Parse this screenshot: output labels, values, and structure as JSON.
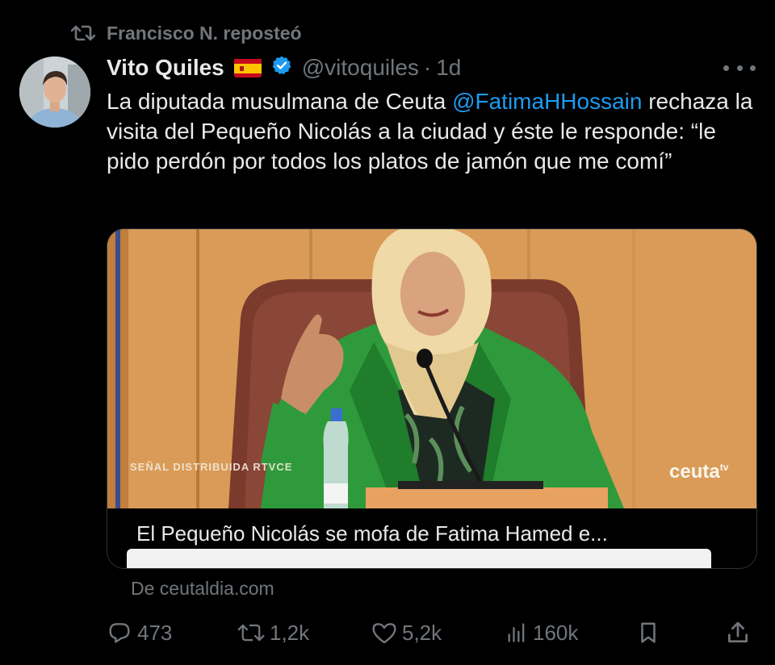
{
  "repost": {
    "text": "Francisco N. reposteó"
  },
  "tweet": {
    "display_name": "Vito Quiles",
    "handle": "@vitoquiles",
    "separator": "·",
    "time": "1d",
    "text_before_mention": "La diputada musulmana de Ceuta ",
    "mention": "@FatimaHHossain",
    "text_after_mention": " rechaza la visita del Pequeño Nicolás a la ciudad y éste le responde: “le pido perdón por todos los platos de jamón que me comí”"
  },
  "card": {
    "video_watermark_left": "SEÑAL DISTRIBUIDA RTVCE",
    "video_watermark_right": "ceuta",
    "video_watermark_right_sup": "tv",
    "title": "El Pequeño Nicolás se mofa de Fatima Hamed e...",
    "source": "De ceutaldia.com"
  },
  "actions": {
    "replies": "473",
    "reposts": "1,2k",
    "likes": "5,2k",
    "views": "160k"
  },
  "colors": {
    "background": "#000000",
    "text_primary": "#e7e9ea",
    "text_secondary": "#71767b",
    "accent_blue": "#1d9bf0",
    "border": "#2f3336"
  },
  "icons": {
    "repost_indicator": "repost-icon",
    "verified": "verified-badge-icon",
    "flag": "spain-flag-icon",
    "more": "more-options-icon",
    "reply": "reply-icon",
    "repost": "repost-icon",
    "like": "heart-icon",
    "views": "views-chart-icon",
    "bookmark": "bookmark-icon",
    "share": "share-icon"
  }
}
